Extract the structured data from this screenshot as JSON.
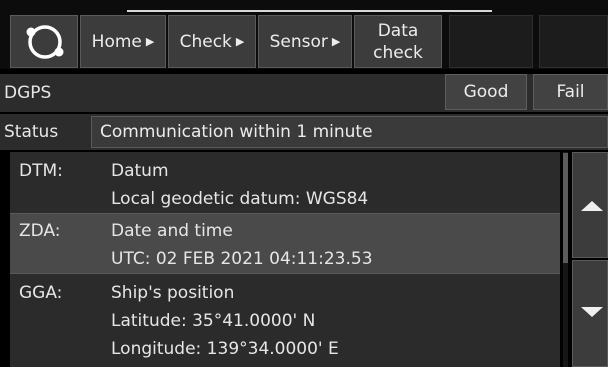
{
  "nav": {
    "home": "Home",
    "check": "Check",
    "sensor": "Sensor",
    "data_check_line1": "Data",
    "data_check_line2": "check"
  },
  "dgps": {
    "label": "DGPS",
    "good_label": "Good",
    "fail_label": "Fail"
  },
  "status": {
    "label": "Status",
    "value": "Communication within 1 minute"
  },
  "sentences": [
    {
      "code": "DTM:",
      "lines": [
        "Datum",
        "Local geodetic datum: WGS84"
      ]
    },
    {
      "code": "ZDA:",
      "lines": [
        "Date and time",
        "UTC: 02 FEB 2021 04:11:23.53"
      ]
    },
    {
      "code": "GGA:",
      "lines": [
        "Ship's position",
        "Latitude: 35°41.0000' N",
        "Longitude: 139°34.0000' E"
      ]
    }
  ],
  "selected_index": 1,
  "icons": {
    "logo": "circle-logo-icon",
    "nav_arrow": "triangle-right-icon",
    "scroll_up": "triangle-up-icon",
    "scroll_down": "triangle-down-icon"
  },
  "colors": {
    "background": "#000000",
    "button": "#3c3c3c",
    "selected_row": "#4a4a4a",
    "list_background": "#2b2b2b",
    "text": "#e6e6e6"
  }
}
